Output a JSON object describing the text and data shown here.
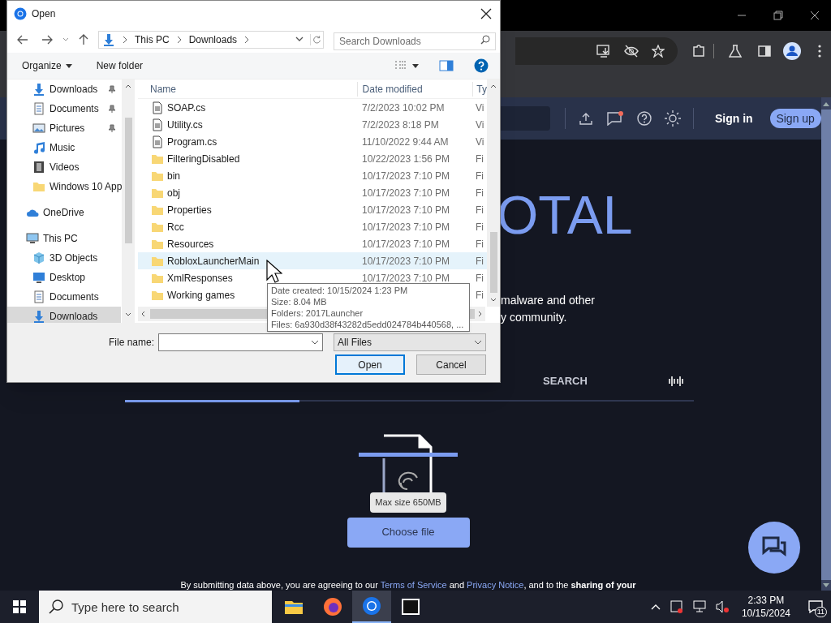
{
  "browser": {
    "site_header": {
      "sign_in": "Sign in",
      "sign_up": "Sign up"
    },
    "heading": "OTAL",
    "description": [
      "malware and other",
      "y community."
    ],
    "tabs": [
      {
        "label": "SEARCH",
        "selected": false
      }
    ],
    "upload": {
      "hint": "Max size 650MB",
      "button": "Choose file"
    },
    "consent": [
      {
        "kind": "text",
        "text": "By submitting data above, you are agreeing to our "
      },
      {
        "kind": "link",
        "text": "Terms of Service"
      },
      {
        "kind": "text",
        "text": " and "
      },
      {
        "kind": "link",
        "text": "Privacy Notice"
      },
      {
        "kind": "text",
        "text": ", and to the **sharing of your**"
      }
    ]
  },
  "dialog": {
    "title": "Open",
    "path": [
      "This PC",
      "Downloads"
    ],
    "search": {
      "placeholder": "Search Downloads"
    },
    "toolbar": {
      "organize": "Organize",
      "new_folder": "New folder"
    },
    "nav_pane": {
      "quick_access": [
        {
          "label": "Downloads",
          "kind": "downloads",
          "pinned": true,
          "selected": false
        },
        {
          "label": "Documents",
          "kind": "documents",
          "pinned": true,
          "selected": false
        },
        {
          "label": "Pictures",
          "kind": "pictures",
          "pinned": true,
          "selected": false
        },
        {
          "label": "Music",
          "kind": "music",
          "pinned": false,
          "selected": false
        },
        {
          "label": "Videos",
          "kind": "videos",
          "pinned": false,
          "selected": false
        },
        {
          "label": "Windows 10 App",
          "kind": "folder",
          "pinned": false,
          "selected": false
        }
      ],
      "locations": [
        {
          "label": "OneDrive",
          "kind": "onedrive",
          "selected": false
        },
        {
          "label": "This PC",
          "kind": "pc",
          "selected": false,
          "children": [
            {
              "label": "3D Objects",
              "kind": "objects3d",
              "selected": false
            },
            {
              "label": "Desktop",
              "kind": "desktop",
              "selected": false
            },
            {
              "label": "Documents",
              "kind": "documents",
              "selected": false
            },
            {
              "label": "Downloads",
              "kind": "downloads",
              "selected": true
            }
          ]
        }
      ]
    },
    "columns": [
      "Name",
      "Date modified",
      "Ty"
    ],
    "files": [
      {
        "name": "SOAP.cs",
        "date": "7/2/2023 10:02 PM",
        "type": "Vi",
        "kind": "file",
        "hovered": false
      },
      {
        "name": "Utility.cs",
        "date": "7/2/2023 8:18 PM",
        "type": "Vi",
        "kind": "file",
        "hovered": false
      },
      {
        "name": "Program.cs",
        "date": "11/10/2022 9:44 AM",
        "type": "Vi",
        "kind": "file",
        "hovered": false
      },
      {
        "name": "FilteringDisabled",
        "date": "10/22/2023 1:56 PM",
        "type": "Fi",
        "kind": "folder",
        "hovered": false
      },
      {
        "name": "bin",
        "date": "10/17/2023 7:10 PM",
        "type": "Fi",
        "kind": "folder",
        "hovered": false
      },
      {
        "name": "obj",
        "date": "10/17/2023 7:10 PM",
        "type": "Fi",
        "kind": "folder",
        "hovered": false
      },
      {
        "name": "Properties",
        "date": "10/17/2023 7:10 PM",
        "type": "Fi",
        "kind": "folder",
        "hovered": false
      },
      {
        "name": "Rcc",
        "date": "10/17/2023 7:10 PM",
        "type": "Fi",
        "kind": "folder",
        "hovered": false
      },
      {
        "name": "Resources",
        "date": "10/17/2023 7:10 PM",
        "type": "Fi",
        "kind": "folder",
        "hovered": false
      },
      {
        "name": "RobloxLauncherMain",
        "date": "10/17/2023 7:10 PM",
        "type": "Fi",
        "kind": "folder",
        "hovered": true
      },
      {
        "name": "XmlResponses",
        "date": "10/17/2023 7:10 PM",
        "type": "Fi",
        "kind": "folder",
        "hovered": false
      },
      {
        "name": "Working games",
        "type": "Fi",
        "kind": "folder",
        "hovered": false
      }
    ],
    "tooltip": [
      "Date created: 10/15/2024 1:23 PM",
      "Size: 8.04 MB",
      "Folders: 2017Launcher",
      "Files: 6a930d38f43282d5edd024784b440568, ..."
    ],
    "file_name": {
      "label": "File name:"
    },
    "file_type": "All Files",
    "buttons": [
      {
        "label": "Open",
        "default": true
      },
      {
        "label": "Cancel",
        "default": false
      }
    ]
  },
  "taskbar": {
    "search": {
      "placeholder": "Type here to search"
    },
    "apps": [
      {
        "kind": "explorer",
        "active": false
      },
      {
        "kind": "firefox",
        "active": false
      },
      {
        "kind": "chrome",
        "active": true
      },
      {
        "kind": "sevenzip",
        "active": false
      }
    ],
    "time": "2:33 PM",
    "date": "10/15/2024",
    "notifications": "11"
  }
}
